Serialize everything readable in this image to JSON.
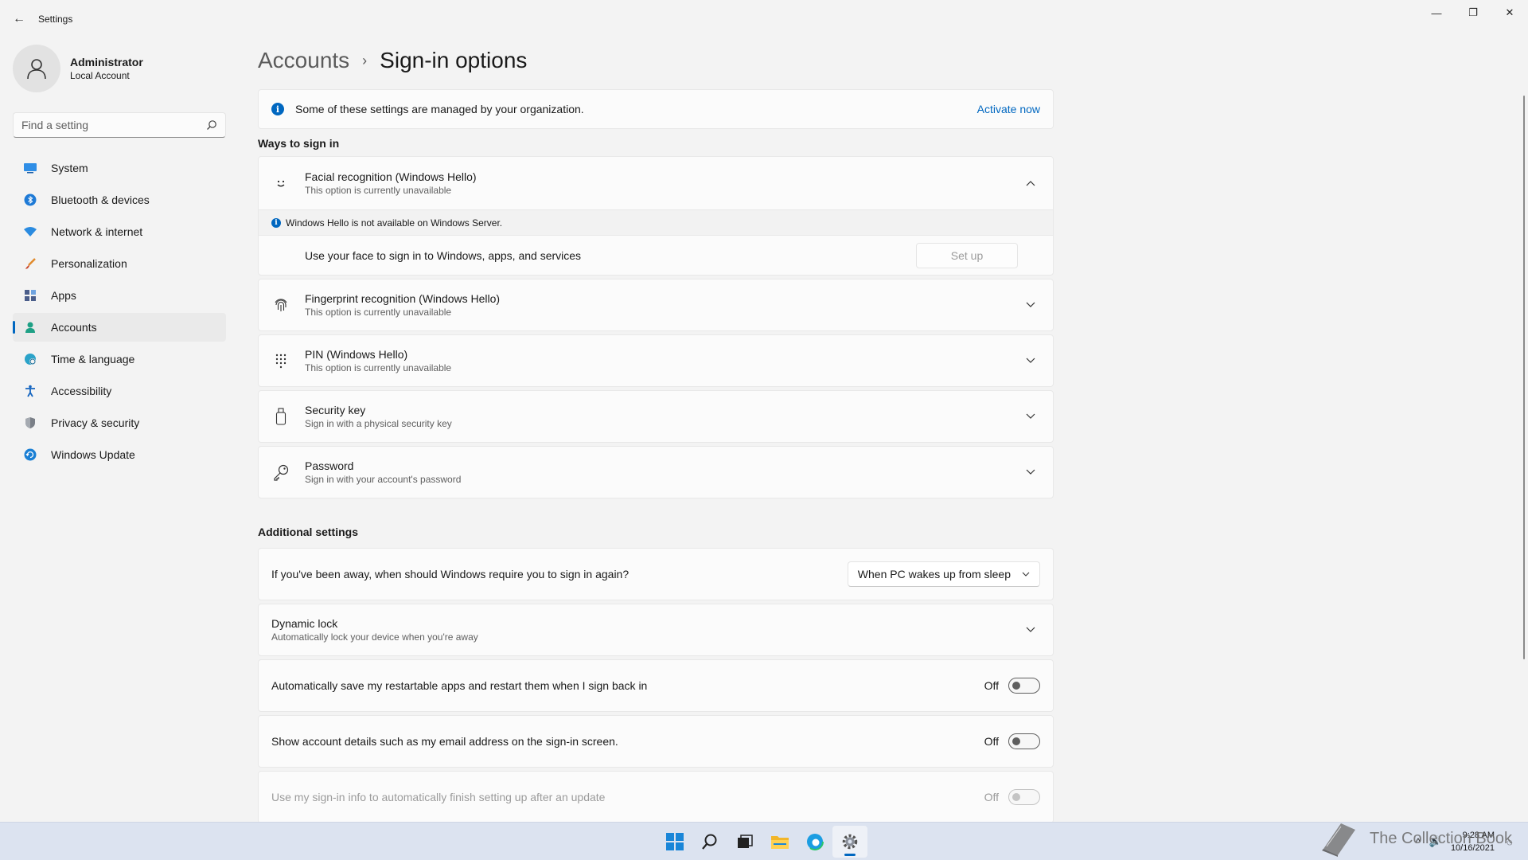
{
  "window": {
    "app_title": "Settings",
    "back_glyph": "←",
    "minimize_glyph": "—",
    "restore_glyph": "❐",
    "close_glyph": "✕"
  },
  "profile": {
    "name": "Administrator",
    "account_type": "Local Account"
  },
  "search": {
    "placeholder": "Find a setting"
  },
  "nav": {
    "items": [
      {
        "label": "System",
        "icon": "system-icon"
      },
      {
        "label": "Bluetooth & devices",
        "icon": "bluetooth-icon"
      },
      {
        "label": "Network & internet",
        "icon": "wifi-icon"
      },
      {
        "label": "Personalization",
        "icon": "brush-icon"
      },
      {
        "label": "Apps",
        "icon": "apps-icon"
      },
      {
        "label": "Accounts",
        "icon": "accounts-icon",
        "active": true
      },
      {
        "label": "Time & language",
        "icon": "globe-clock-icon"
      },
      {
        "label": "Accessibility",
        "icon": "accessibility-icon"
      },
      {
        "label": "Privacy & security",
        "icon": "shield-icon"
      },
      {
        "label": "Windows Update",
        "icon": "update-icon"
      }
    ]
  },
  "breadcrumb": {
    "parent": "Accounts",
    "separator": "›",
    "current": "Sign-in options"
  },
  "notice": {
    "text": "Some of these settings are managed by your organization.",
    "link": "Activate now",
    "info_glyph": "i"
  },
  "ways": {
    "title": "Ways to sign in",
    "facial": {
      "title": "Facial recognition (Windows Hello)",
      "subtitle": "This option is currently unavailable",
      "warning": "Windows Hello is not available on Windows Server.",
      "row_text": "Use your face to sign in to Windows, apps, and services",
      "button": "Set up"
    },
    "fingerprint": {
      "title": "Fingerprint recognition (Windows Hello)",
      "subtitle": "This option is currently unavailable"
    },
    "pin": {
      "title": "PIN (Windows Hello)",
      "subtitle": "This option is currently unavailable"
    },
    "security_key": {
      "title": "Security key",
      "subtitle": "Sign in with a physical security key"
    },
    "password": {
      "title": "Password",
      "subtitle": "Sign in with your account's password"
    }
  },
  "additional": {
    "title": "Additional settings",
    "require_signin": {
      "label": "If you've been away, when should Windows require you to sign in again?",
      "selected": "When PC wakes up from sleep"
    },
    "dynamic_lock": {
      "title": "Dynamic lock",
      "subtitle": "Automatically lock your device when you're away"
    },
    "restart_apps": {
      "label": "Automatically save my restartable apps and restart them when I sign back in",
      "state": "Off"
    },
    "account_details": {
      "label": "Show account details such as my email address on the sign-in screen.",
      "state": "Off"
    },
    "signin_info": {
      "label": "Use my sign-in info to automatically finish setting up after an update",
      "state": "Off"
    }
  },
  "taskbar": {
    "clock_time": "9:28 AM",
    "clock_date": "10/16/2021",
    "tray_chevron": "^",
    "tray_speaker": "🔊",
    "tray_notify": "◌"
  },
  "watermark": {
    "text": "The Collection Book"
  },
  "colors": {
    "accent": "#0067c0",
    "background": "#f3f3f3",
    "card": "#fbfbfb"
  }
}
